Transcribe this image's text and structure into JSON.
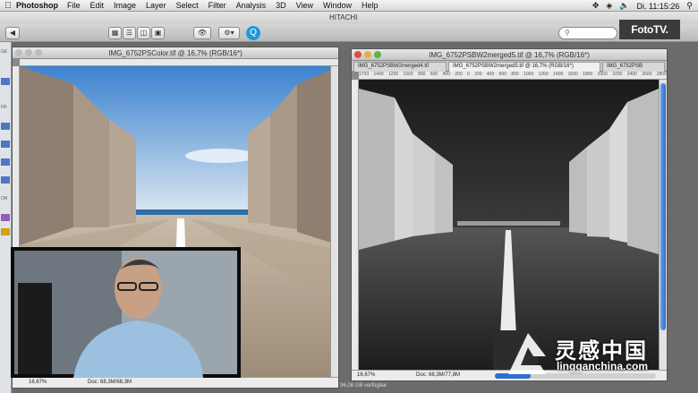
{
  "menubar": {
    "app": "Photoshop",
    "items": [
      "File",
      "Edit",
      "Image",
      "Layer",
      "Select",
      "Filter",
      "Analysis",
      "3D",
      "View",
      "Window",
      "Help"
    ],
    "clock": "Di. 11:15:26"
  },
  "finder": {
    "title": "HITACHI"
  },
  "brand": {
    "fototv": "FotoTV."
  },
  "doc_left": {
    "title": "IMG_6752PSColor.tif @ 16,7% (RGB/16*)",
    "zoom": "16,67%",
    "doc_info": "Doc: 68,3M/68,3M"
  },
  "doc_right": {
    "title": "IMG_6752PSBW2merged5.tif @ 16,7% (RGB/16*)",
    "tabs": [
      "IMG_6752PSBW2merged4.tif",
      "IMG_6752PSBW2merged5.tif @ 16,7% (RGB/16*)",
      "IMG_6752PSB"
    ],
    "zoom": "16,67%",
    "doc_info": "Doc: 68,3M/77,8M",
    "ruler_numbers": [
      "1700",
      "1400",
      "1200",
      "1000",
      "800",
      "600",
      "400",
      "200",
      "0",
      "200",
      "400",
      "600",
      "800",
      "1000",
      "1200",
      "1400",
      "1600",
      "1800",
      "2000",
      "2200",
      "2400",
      "2600",
      "2800",
      "3000"
    ]
  },
  "sidebar_labels": [
    "GE",
    "FR",
    "OR"
  ],
  "footer": {
    "disk": "96,08 GB verfügbar"
  },
  "watermark": {
    "cn": "灵感中国",
    "url": "lingganchina.com"
  },
  "colors": {
    "accent_blue": "#2f6dd1",
    "close_red": "#e04b3e",
    "min_yellow": "#e3b13a",
    "zoom_green": "#5cb544"
  }
}
